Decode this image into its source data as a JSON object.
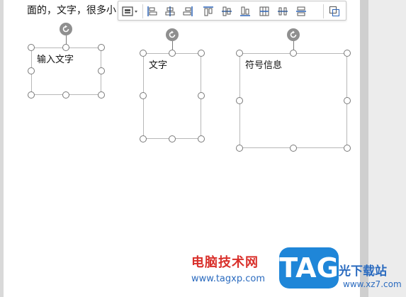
{
  "document": {
    "top_text": "面的，文字，很多小"
  },
  "toolbar": {
    "buttons": [
      {
        "name": "text-box-options-button",
        "icon": "textbox-dropdown-icon"
      },
      {
        "name": "align-left-button",
        "icon": "align-left-icon"
      },
      {
        "name": "align-center-button",
        "icon": "align-center-icon"
      },
      {
        "name": "align-right-button",
        "icon": "align-right-icon"
      },
      {
        "name": "align-top-button",
        "icon": "align-top-icon"
      },
      {
        "name": "align-middle-button",
        "icon": "align-middle-icon"
      },
      {
        "name": "align-bottom-button",
        "icon": "align-bottom-icon"
      },
      {
        "name": "distribute-horizontal-button",
        "icon": "distribute-horizontal-icon"
      },
      {
        "name": "distribute-vertical-button",
        "icon": "distribute-vertical-icon"
      },
      {
        "name": "equal-spacing-button",
        "icon": "equal-spacing-icon"
      },
      {
        "name": "group-button",
        "icon": "group-icon"
      }
    ]
  },
  "text_boxes": [
    {
      "label": "输入文字"
    },
    {
      "label": "文字"
    },
    {
      "label": "符号信息"
    }
  ],
  "watermark": {
    "site_name": "电脑技术网",
    "site_url": "www.tagxp.com",
    "logo_text": "TAG",
    "site_name2": "光下载站",
    "site_url2": "www.xz7.com"
  },
  "colors": {
    "accent_red": "#d9302b",
    "accent_blue": "#2b6bbf",
    "logo_bg": "#1f86d8",
    "handle_border": "#7a7a7a"
  }
}
